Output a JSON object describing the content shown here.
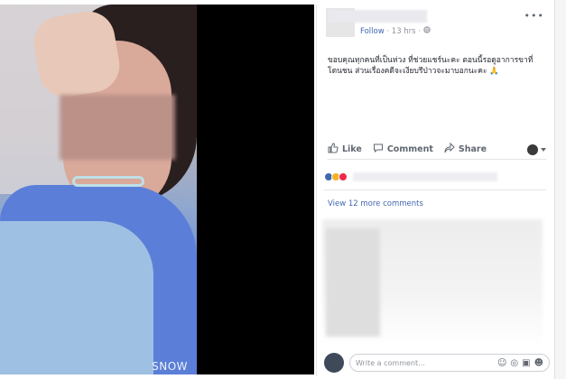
{
  "photo": {
    "watermark": "SNOW"
  },
  "post": {
    "follow": "Follow",
    "time": "13 hrs",
    "text": "ขอบคุณทุกคนที่เป็นห่วง ที่ช่วยแชร์นะคะ ตอนนี้รอดูอาการขาที่โดนชน ส่วนเรื่องคดีจะเงียบรึป่าวจะมาบอกนะคะ 🙏",
    "actions": {
      "like": "Like",
      "comment": "Comment",
      "share": "Share"
    },
    "view_more": "View 12 more comments",
    "composer_placeholder": "Write a comment..."
  },
  "colors": {
    "link": "#4267b2",
    "meta": "#90949c",
    "like": "#4267b2",
    "wow": "#f7b125",
    "love": "#f0284a"
  },
  "icons": [
    "more-icon",
    "globe-icon",
    "like-icon",
    "comment-icon",
    "share-icon",
    "emoji-icon",
    "camera-icon",
    "gif-icon",
    "sticker-icon"
  ]
}
